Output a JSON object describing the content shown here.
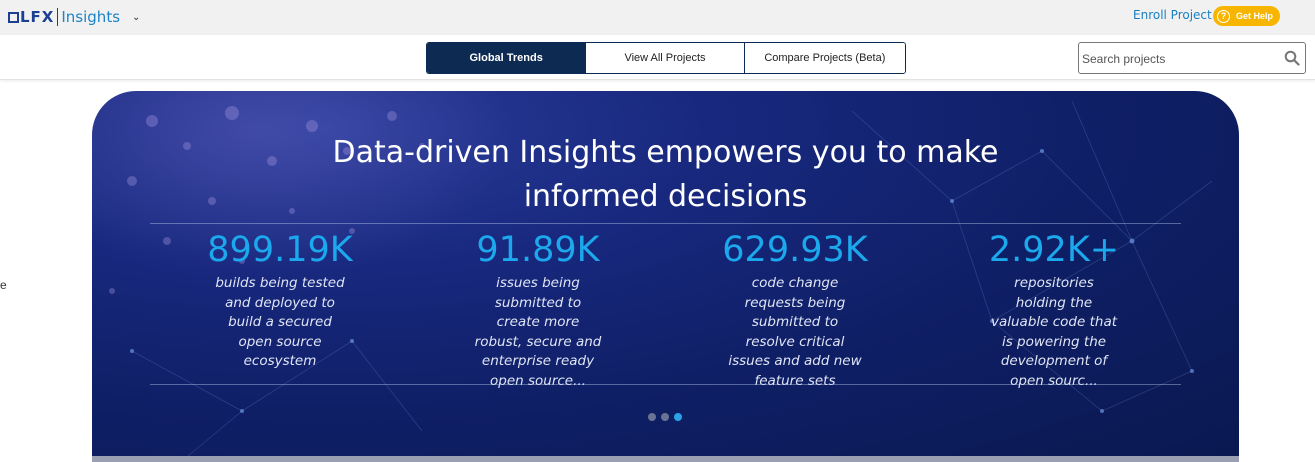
{
  "header": {
    "logo_text": "LFX",
    "product_name": "Insights",
    "enroll_label": "Enroll Project",
    "help_label": "Get Help",
    "colors": {
      "brand": "#1c3f94",
      "help_badge": "#f7b500",
      "link": "#1a7fc1"
    }
  },
  "nav": {
    "tabs": [
      {
        "label": "Global Trends",
        "active": true
      },
      {
        "label": "View All Projects",
        "active": false
      },
      {
        "label": "Compare Projects (Beta)",
        "active": false
      }
    ],
    "search": {
      "placeholder": "Search projects",
      "value": ""
    }
  },
  "edge_text": "e",
  "hero": {
    "headline_line1": "Data-driven Insights empowers you to make",
    "headline_line2": "informed decisions",
    "stats": [
      {
        "value": "899.19K",
        "description": "builds being tested and deployed to build a secured open source ecosystem"
      },
      {
        "value": "91.89K",
        "description": "issues being submitted to create more robust, secure and enterprise ready open source..."
      },
      {
        "value": "629.93K",
        "description": "code change requests being submitted to resolve critical issues and add new feature sets"
      },
      {
        "value": "2.92K+",
        "description": "repositories holding the valuable code that is powering the development of open sourc..."
      }
    ],
    "carousel": {
      "total": 3,
      "active_index": 2
    },
    "colors": {
      "stat_value": "#1ca8ec",
      "background": "#0f1f66"
    }
  }
}
